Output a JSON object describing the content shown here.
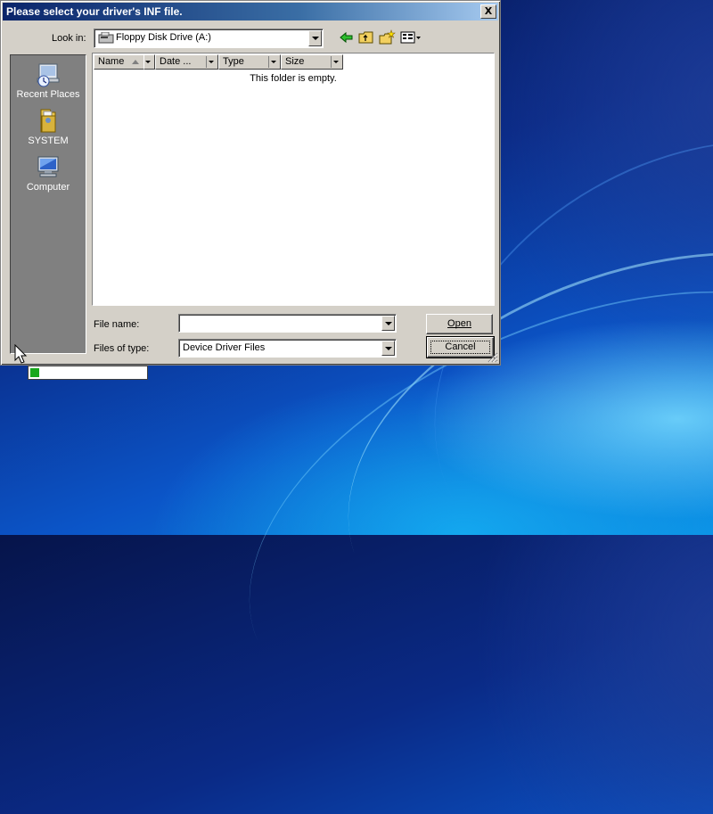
{
  "dialog": {
    "title": "Please select your driver's INF file.",
    "close_label": "X"
  },
  "lookin": {
    "label": "Look in:",
    "value": "Floppy Disk Drive (A:)"
  },
  "toolbar": {
    "icons": [
      "back-arrow-icon",
      "up-folder-icon",
      "new-folder-icon",
      "view-menu-icon"
    ]
  },
  "places": [
    {
      "label": "Recent Places",
      "icon": "recent-places-icon"
    },
    {
      "label": "SYSTEM",
      "icon": "user-folder-icon"
    },
    {
      "label": "Computer",
      "icon": "computer-icon"
    }
  ],
  "filelist": {
    "columns": [
      "Name",
      "Date ...",
      "Type",
      "Size"
    ],
    "empty_message": "This folder is empty."
  },
  "filename": {
    "label": "File name:",
    "value": ""
  },
  "filetype": {
    "label": "Files of type:",
    "value": "Device Driver Files"
  },
  "buttons": {
    "open_label": "Open",
    "cancel_label": "Cancel"
  },
  "progress": {
    "percent": 8,
    "color": "#18a81c"
  },
  "colors": {
    "title_bar": "#0a246a",
    "dialog_face": "#d4d0c8"
  }
}
